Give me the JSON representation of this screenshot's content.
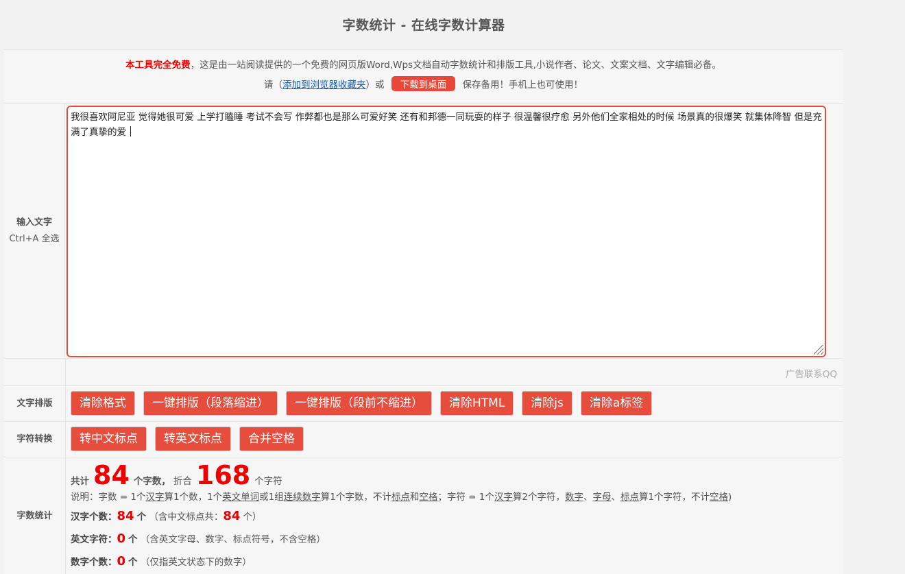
{
  "title": "字数统计 - 在线字数计算器",
  "notice": {
    "free_label": "本工具完全免费",
    "text": "，这是由一站阅读提供的一个免费的网页版Word,Wps文档自动字数统计和排版工具,小说作者、论文、文案文档、文字编辑必备。",
    "please": "请（",
    "bookmark_link": "添加到浏览器收藏夹",
    "or": "）或",
    "download_button": "下载到桌面",
    "save_text": "保存备用！手机上也可使用！"
  },
  "input": {
    "label_bold": "输入文字",
    "label_hint": "Ctrl+A 全选",
    "value": "我很喜欢阿尼亚 觉得她很可爱 上学打瞌睡 考试不会写 作弊都也是那么可爱好笑 还有和邦德一同玩耍的样子 很温馨很疗愈 另外他们全家相处的时候 场景真的很爆笑 就集体降智 但是充满了真挚的爱 "
  },
  "ad": "广告联系QQ",
  "formatting": {
    "label": "文字排版",
    "buttons": [
      "清除格式",
      "一键排版（段落缩进）",
      "一键排版（段前不缩进）",
      "清除HTML",
      "清除js",
      "清除a标签"
    ]
  },
  "conversion": {
    "label": "字符转换",
    "buttons": [
      "转中文标点",
      "转英文标点",
      "合并空格"
    ]
  },
  "stats": {
    "label": "字数统计",
    "total_prefix": "共计",
    "word_count": "84",
    "word_unit": "个字数，",
    "equal_label": "折合",
    "char_count": "168",
    "char_unit": "个字符",
    "explain": {
      "p1": "说明：字数 = 1个",
      "u1": "汉字",
      "p2": "算1个数，1个",
      "u2": "英文单词",
      "p3": "或1组",
      "u3": "连续数字",
      "p4": "算1个字数，不计",
      "u4": "标点",
      "p5": "和",
      "u5": "空格",
      "p6": "；字符 = 1个",
      "u6": "汉字",
      "p7": "算2个字符，",
      "u7": "数字",
      "p8": "、",
      "u8": "字母",
      "p9": "、",
      "u9": "标点",
      "p10": "算1个字符，不计",
      "u10": "空格",
      "p11": ")"
    },
    "hanzi_label": "汉字个数：",
    "hanzi_count": "84",
    "hanzi_unit": "个",
    "hanzi_note_pre": "（含中文标点共：",
    "hanzi_punct": "84",
    "hanzi_note_post": "个）",
    "english_label": "英文字符：",
    "english_count": "0",
    "english_unit": "个",
    "english_note": "（含英文字母、数字、标点符号，不含空格）",
    "digit_label": "数字个数：",
    "digit_count": "0",
    "digit_unit": "个",
    "digit_note": "（仅指英文状态下的数字）"
  }
}
